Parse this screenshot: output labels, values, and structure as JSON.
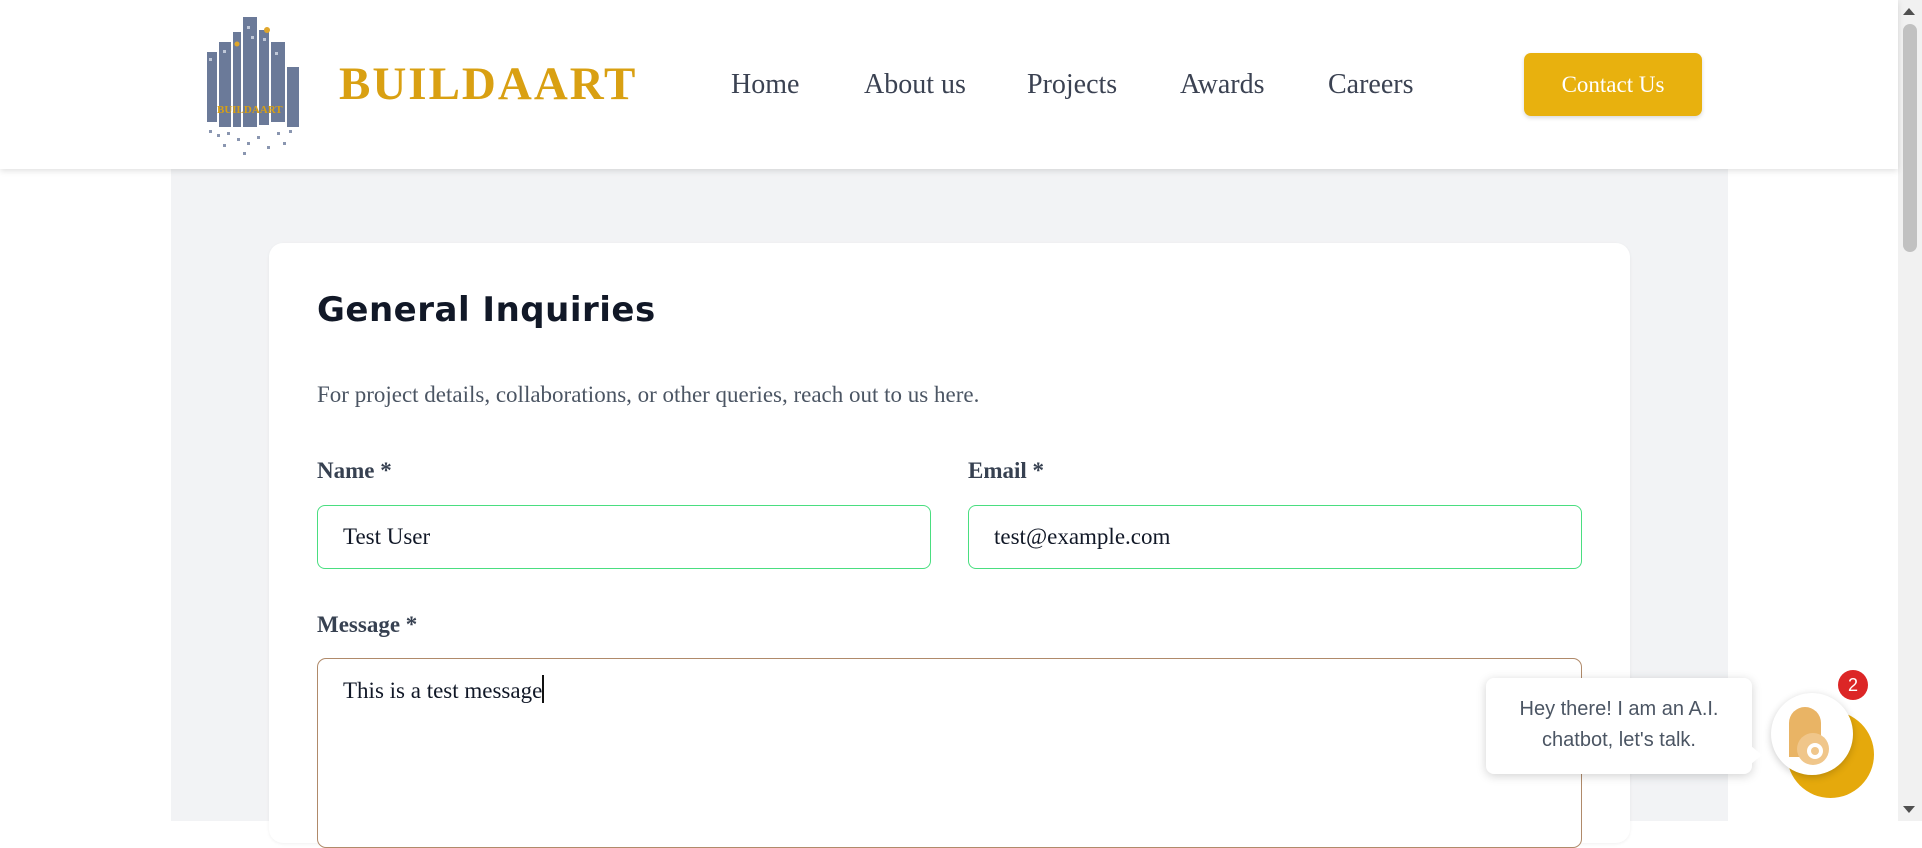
{
  "header": {
    "brand": "BUILDAART",
    "logo_label": "BUILDAART",
    "nav": [
      {
        "label": "Home"
      },
      {
        "label": "About us"
      },
      {
        "label": "Projects"
      },
      {
        "label": "Awards"
      },
      {
        "label": "Careers"
      }
    ],
    "contact_label": "Contact Us"
  },
  "form": {
    "title": "General Inquiries",
    "subtitle": "For project details, collaborations, or other queries, reach out to us here.",
    "name_label": "Name *",
    "name_value": "Test User",
    "email_label": "Email *",
    "email_value": "test@example.com",
    "message_label": "Message *",
    "message_value": "This is a test message"
  },
  "chatbot": {
    "line1": "Hey there! I am an A.I.",
    "line2": "chatbot, let's talk.",
    "badge_count": "2"
  },
  "colors": {
    "brand": "#d9a012",
    "accent_button": "#e8b10e",
    "valid_border": "#4ade80",
    "badge": "#dc2626"
  }
}
